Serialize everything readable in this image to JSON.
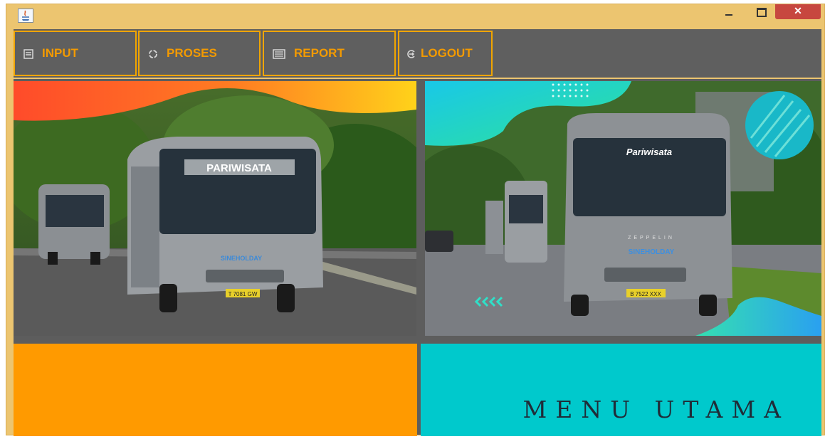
{
  "toolbar": {
    "items": [
      {
        "label": "INPUT",
        "icon": "list-icon"
      },
      {
        "label": "PROSES",
        "icon": "refresh-icon"
      },
      {
        "label": "REPORT",
        "icon": "report-icon"
      },
      {
        "label": "LOGOUT",
        "icon": "logout-icon"
      }
    ]
  },
  "photos": {
    "left": {
      "sign": "PARIWISATA",
      "side_label": "SINEHOLDAY",
      "plate": "T 7081 GW"
    },
    "right": {
      "sign": "Pariwisata",
      "side_label": "SINEHOLDAY",
      "plate": "B 7522 XXX",
      "front_label": "ZEPPELIN"
    }
  },
  "main": {
    "title": "MENU UTAMA"
  },
  "colors": {
    "accent": "#ff9a00",
    "teal": "#00c9cc",
    "toolbar": "#5f5f5f",
    "frame": "#ecc570"
  }
}
